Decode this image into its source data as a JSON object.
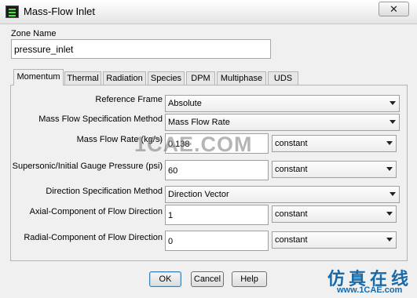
{
  "window": {
    "title": "Mass-Flow Inlet",
    "close_glyph": "✕"
  },
  "zone": {
    "label": "Zone Name",
    "value": "pressure_inlet"
  },
  "tabs": [
    {
      "label": "Momentum"
    },
    {
      "label": "Thermal"
    },
    {
      "label": "Radiation"
    },
    {
      "label": "Species"
    },
    {
      "label": "DPM"
    },
    {
      "label": "Multiphase"
    },
    {
      "label": "UDS"
    }
  ],
  "momentum": {
    "reference_frame": {
      "label": "Reference Frame",
      "value": "Absolute"
    },
    "mass_flow_spec": {
      "label": "Mass Flow Specification Method",
      "value": "Mass Flow Rate"
    },
    "mass_flow_rate": {
      "label": "Mass Flow Rate (kg/s)",
      "value": "0.138",
      "method": "constant"
    },
    "gauge_pressure": {
      "label": "Supersonic/Initial Gauge Pressure (psi)",
      "value": "60",
      "method": "constant"
    },
    "direction_spec": {
      "label": "Direction Specification Method",
      "value": "Direction Vector"
    },
    "axial": {
      "label": "Axial-Component of Flow Direction",
      "value": "1",
      "method": "constant"
    },
    "radial": {
      "label": "Radial-Component of Flow Direction",
      "value": "0",
      "method": "constant"
    }
  },
  "buttons": {
    "ok": "OK",
    "cancel": "Cancel",
    "help": "Help"
  },
  "watermark": {
    "text": "1CAE.COM",
    "brand_cn": "仿真在线",
    "brand_url": "www.1CAE.com"
  },
  "colors": {
    "brand": "#1a6aa8",
    "accent_green": "#3ee83e"
  }
}
